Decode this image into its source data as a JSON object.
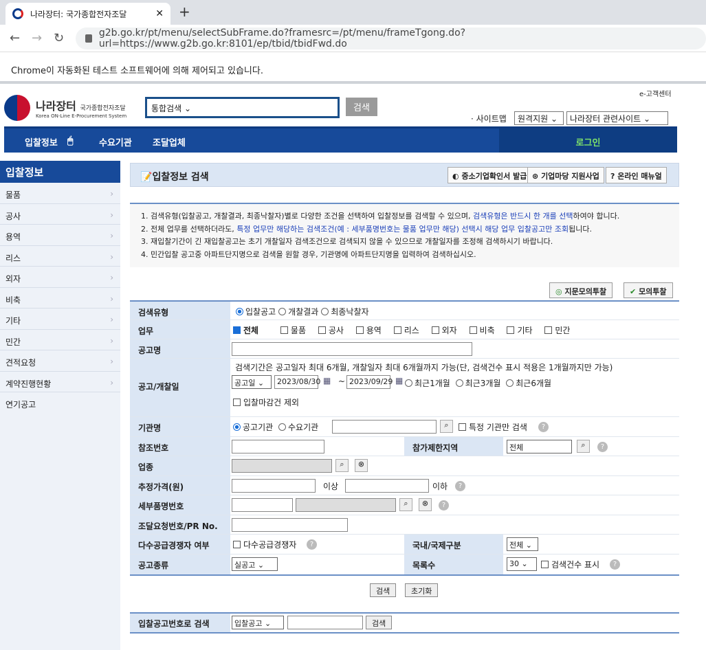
{
  "browser": {
    "tab_title": "나라장터: 국가종합전자조달",
    "url": "g2b.go.kr/pt/menu/selectSubFrame.do?framesrc=/pt/menu/frameTgong.do?url=https://www.g2b.go.kr:8101/ep/tbid/tbidFwd.do",
    "infobar": "Chrome이 자동화된 테스트 소프트웨어에 의해 제어되고 있습니다."
  },
  "header": {
    "logo_main": "나라장터",
    "logo_sub": "국가종합전자조달",
    "logo_en": "Korea ON-Line E-Procurement System",
    "search_select": "통합검색",
    "search_button": "검색",
    "customer_center": "e-고객센터",
    "sitemap": "· 사이트맵",
    "remote_select": "원격지원",
    "related_select": "나라장터 관련사이트"
  },
  "gnb": {
    "items": [
      "입찰정보",
      "수요기관",
      "조달업체"
    ],
    "login": "로그인"
  },
  "lnb": {
    "title": "입찰정보",
    "items": [
      "물품",
      "공사",
      "용역",
      "리스",
      "외자",
      "비축",
      "기타",
      "민간",
      "견적요청",
      "계약진행현황",
      "연기공고"
    ]
  },
  "page": {
    "title": "입찰정보 검색",
    "buttons": [
      "중소기업확인서 발급",
      "기업마당 지원사업",
      "온라인 매뉴얼"
    ]
  },
  "notice": {
    "line1a": "1. 검색유형(입찰공고, 개찰결과, 최종낙찰자)별로 다양한 조건을 선택하여 입찰정보를 검색할 수 있으며, ",
    "line1b": "검색유형은 반드시 한 개를 선택",
    "line1c": "하여야 합니다.",
    "line2a": "2. 전체 업무를 선택하더라도, ",
    "line2b": "특정 업무만 해당하는 검색조건(예 : 세부품명번호는 물품 업무만 해당) 선택시 해당 업무 입찰공고만 조회",
    "line2c": "됩니다.",
    "line3": "3. 재입찰기간이 긴 재입찰공고는 초기 개찰일자 검색조건으로 검색되지 않을 수 있으므로 개찰일자를 조정해 검색하시기 바랍니다.",
    "line4": "4. 민간입찰 공고중 아파트단지명으로 검색을 원할 경우, 기관명에 아파트단지명을 입력하여 검색하십시오."
  },
  "actions": {
    "fingerprint": "지문모의투찰",
    "mock": "모의투찰"
  },
  "form": {
    "search_type": {
      "label": "검색유형",
      "options": [
        "입찰공고",
        "개찰결과",
        "최종낙찰자"
      ]
    },
    "work": {
      "label": "업무",
      "options": [
        "전체",
        "물품",
        "공사",
        "용역",
        "리스",
        "외자",
        "비축",
        "기타",
        "민간"
      ]
    },
    "notice_name": {
      "label": "공고명",
      "value": ""
    },
    "period": {
      "label": "공고/개찰일",
      "note": "검색기간은 공고일자 최대 6개월, 개찰일자 최대 6개월까지 가능(단, 검색건수 표시 적용은 1개월까지만 가능)",
      "date_type": "공고일",
      "from": "2023/08/30",
      "tilde": "~",
      "to": "2023/09/29",
      "quick": [
        "최근1개월",
        "최근3개월",
        "최근6개월"
      ],
      "exclude_closed": "입찰마감건 제외"
    },
    "agency": {
      "label": "기관명",
      "options": [
        "공고기관",
        "수요기관"
      ],
      "specific": "특정 기관만 검색"
    },
    "ref_no": {
      "label": "참조번호"
    },
    "region": {
      "label": "참가제한지역",
      "value": "전체"
    },
    "industry": {
      "label": "업종"
    },
    "price": {
      "label": "추정가격(원)",
      "above": "이상",
      "below": "이하"
    },
    "detail_no": {
      "label": "세부품명번호"
    },
    "pr_no": {
      "label": "조달요청번호/PR No."
    },
    "multi_supply": {
      "label": "다수공급경쟁자 여부",
      "check": "다수공급경쟁자"
    },
    "intl": {
      "label": "국내/국제구분",
      "value": "전체"
    },
    "notice_kind": {
      "label": "공고종류",
      "value": "실공고"
    },
    "list_count": {
      "label": "목록수",
      "value": "30",
      "show_count": "검색건수 표시"
    }
  },
  "buttons": {
    "search": "검색",
    "reset": "초기화"
  },
  "bid_no_search": {
    "label": "입찰공고번호로 검색",
    "select": "입찰공고",
    "button": "검색"
  }
}
